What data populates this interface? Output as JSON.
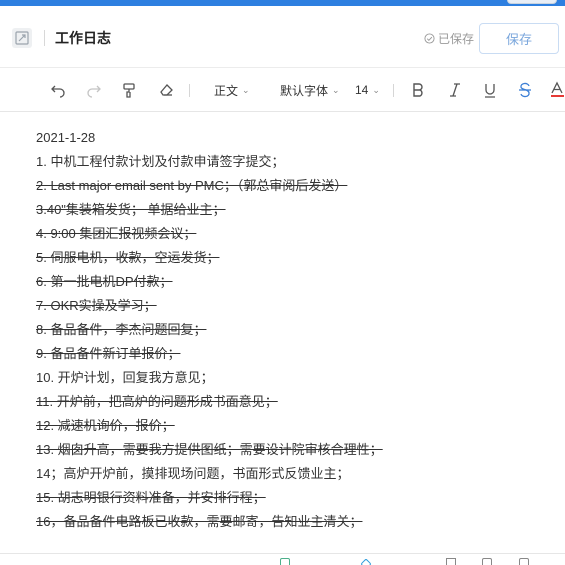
{
  "header": {
    "title": "工作日志",
    "saved_status": "已保存",
    "save_label": "保存"
  },
  "toolbar": {
    "paragraph_style": "正文",
    "font_family": "默认字体",
    "font_size": "14",
    "icons": [
      "undo-icon",
      "redo-icon",
      "format-painter-icon",
      "eraser-icon",
      "bold-icon",
      "italic-icon",
      "underline-icon",
      "strikethrough-icon",
      "font-color-icon"
    ]
  },
  "document": {
    "lines": [
      {
        "text": "2021-1-28",
        "strike": false
      },
      {
        "text": "1. 中机工程付款计划及付款申请签字提交；",
        "strike": false
      },
      {
        "text": "2. Last major email sent by PMC；（郭总审阅后发送）",
        "strike": true
      },
      {
        "text": "3.40\"集装箱发货； 单据给业主；",
        "strike": true
      },
      {
        "text": "4. 9:00 集团汇报视频会议；",
        "strike": true
      },
      {
        "text": "5. 伺服电机，收款，空运发货；",
        "strike": true
      },
      {
        "text": "6. 第一批电机DP付款；",
        "strike": true
      },
      {
        "text": "7. OKR实操及学习；",
        "strike": true
      },
      {
        "text": "8. 备品备件，李杰问题回复；",
        "strike": true
      },
      {
        "text": "9. 备品备件新订单报价；",
        "strike": true
      },
      {
        "text": "10. 开炉计划，回复我方意见；",
        "strike": false
      },
      {
        "text": "11. 开炉前，把高炉的问题形成书面意见；",
        "strike": true
      },
      {
        "text": "12. 减速机询价，报价；",
        "strike": true
      },
      {
        "text": "13. 烟囱升高，需要我方提供图纸；需要设计院审核合理性；",
        "strike": true
      },
      {
        "text": "14；高炉开炉前，摸排现场问题，书面形式反馈业主；",
        "strike": false
      },
      {
        "text": "15. 胡志明银行资料准备，并安排行程；",
        "strike": true
      },
      {
        "text": "16，备品备件电路板已收款，需要邮寄，告知业主清关；",
        "strike": true
      }
    ]
  },
  "colors": {
    "accent": "#2d7fe0",
    "save_button_text": "#7aa6dc",
    "font_color_underline": "#e53935"
  }
}
